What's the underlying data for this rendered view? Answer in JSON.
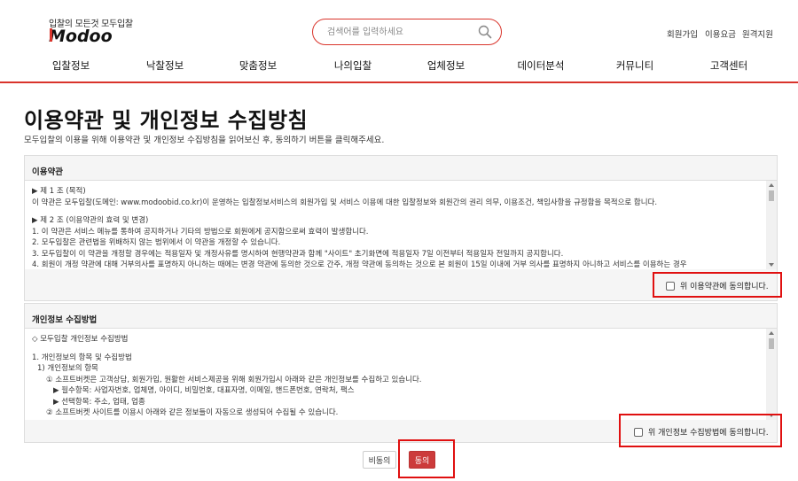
{
  "header": {
    "logo_tagline": "입찰의 모든것 모두입찰",
    "logo_text": "Modoo",
    "search_placeholder": "검색어를 입력하세요",
    "util_links": [
      "회원가입",
      "이용요금",
      "원격지원"
    ]
  },
  "nav": {
    "items": [
      "입찰정보",
      "낙찰정보",
      "맞춤정보",
      "나의입찰",
      "업체정보",
      "데이터분석",
      "커뮤니티",
      "고객센터"
    ]
  },
  "page": {
    "title": "이용약관 및 개인정보 수집방침",
    "description": "모두입찰의 이용을 위해 이용약관 및 개인정보 수집방침을 읽어보신 후, 동의하기 버튼을 클릭해주세요."
  },
  "terms": {
    "heading": "이용약관",
    "lines": [
      "▶ 제 1 조 (목적)",
      "이 약관은 모두입찰(도메인: www.modoobid.co.kr)이 운영하는 입찰정보서비스의 회원가입 및 서비스 이용에 대한 입찰정보와 회원간의 권리 의무, 이용조건, 책임사항을 규정함을 목적으로 합니다.",
      "",
      "▶ 제 2 조 (이용약관의 효력 및 변경)",
      "1. 이 약관은 서비스 메뉴를 통하여 공지하거나 기타의 방법으로 회원에게 공지함으로써 효력이 발생합니다.",
      "2. 모두입찰은 관련법을 위배하지 않는 범위에서 이 약관을 개정할 수 있습니다.",
      "3. 모두입찰이 이 약관을 개정할 경우에는 적용일자 및 개정사유를 명시하여 현행약관과 함께 \"사이트\" 초기화면에 적용일자 7일 이전부터 적용일자 전일까지 공지합니다.",
      "4. 회원이 개정 약관에 대해 거부의사를 표명하지 아니하는 때에는 변경 약관에 동의한 것으로 간주, 개정 약관에 동의하는 것으로 본 회원이 15일 이내에 거부 의사를 표명하지 아니하고 서비스를 이용하는 경우"
    ],
    "agree_label": "위 이용약관에 동의합니다."
  },
  "privacy": {
    "heading": "개인정보 수집방법",
    "lines": [
      "◇ 모두입찰 개인정보 수집방법",
      "",
      "1. 개인정보의 항목 및 수집방법",
      "1) 개인정보의 항목",
      "① 소프트버켓은 고객상담, 회원가입, 원활한 서비스제공을 위해 회원가입시 아래와 같은 개인정보를 수집하고 있습니다.",
      "▶ 필수항목: 사업자번호, 업체명, 아이디, 비밀번호, 대표자명, 이메일, 핸드폰번호, 연락처, 팩스",
      "▶ 선택항목: 주소, 업태, 업종",
      "② 소프트버켓 사이트를 이용시 아래와 같은 정보들이 자동으로 생성되어 수집될 수 있습니다."
    ],
    "agree_label": "위 개인정보 수집방법에 동의합니다."
  },
  "buttons": {
    "disagree": "비동의",
    "agree": "동의"
  },
  "colors": {
    "accent": "#d9342b",
    "highlight": "#e01010",
    "agree_button": "#cc3b3b"
  }
}
